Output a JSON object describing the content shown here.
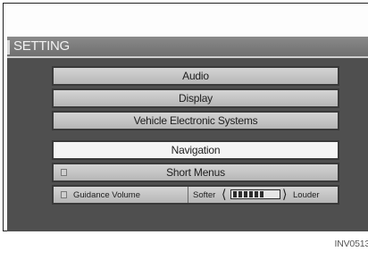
{
  "screen": {
    "title": "SETTING",
    "menu": [
      {
        "label": "Audio",
        "selected": false,
        "indicator": false
      },
      {
        "label": "Display",
        "selected": false,
        "indicator": false
      },
      {
        "label": "Vehicle Electronic Systems",
        "selected": false,
        "indicator": false
      },
      {
        "label": "Navigation",
        "selected": true,
        "indicator": false
      },
      {
        "label": "Short Menus",
        "selected": false,
        "indicator": true
      }
    ],
    "guidance": {
      "label": "Guidance Volume",
      "softer_label": "Softer",
      "louder_label": "Louder",
      "volume_level": 0.8
    }
  },
  "caption": "INV0513"
}
